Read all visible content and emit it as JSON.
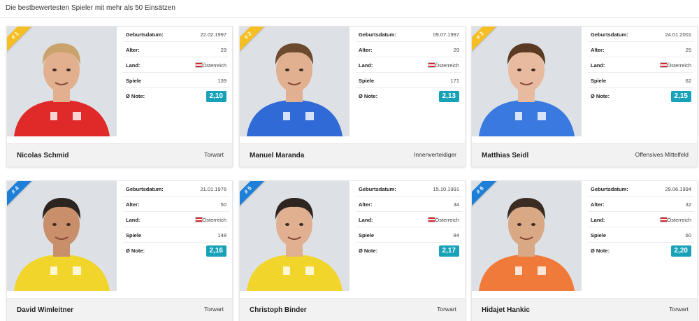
{
  "heading": "Die bestbewertesten Spieler mit mehr als 50 Einsätzen",
  "labels": {
    "birth": "Geburtsdatum:",
    "age": "Alter:",
    "country": "Land:",
    "games": "Spiele",
    "grade": "Ø Note:"
  },
  "colors": {
    "accent": "#17a2b8",
    "rank_top": "#f5bf24",
    "rank_other": "#1d7fd7"
  },
  "players": [
    {
      "rank": "# 1",
      "name": "Nicolas Schmid",
      "position": "Torwart",
      "birth": "22.02.1997",
      "age": "29",
      "country": "Österreich",
      "games": "139",
      "grade": "2,10",
      "kit": "#e02a2a",
      "skin": "#e2b08e",
      "hair": "#c9a36b"
    },
    {
      "rank": "# 2",
      "name": "Manuel Maranda",
      "position": "Innenverteidiger",
      "birth": "09.07.1997",
      "age": "29",
      "country": "Österreich",
      "games": "171",
      "grade": "2,13",
      "kit": "#2f6ad6",
      "skin": "#e0b090",
      "hair": "#6b4a2e"
    },
    {
      "rank": "# 3",
      "name": "Matthias Seidl",
      "position": "Offensives Mittelfeld",
      "birth": "24.01.2001",
      "age": "25",
      "country": "Österreich",
      "games": "62",
      "grade": "2,15",
      "kit": "#3a7ae0",
      "skin": "#e8bba0",
      "hair": "#5a3a22"
    },
    {
      "rank": "# 4",
      "name": "David Wimleitner",
      "position": "Torwart",
      "birth": "21.01.1976",
      "age": "50",
      "country": "Österreich",
      "games": "148",
      "grade": "2,16",
      "kit": "#f2d52a",
      "skin": "#c98f6a",
      "hair": "#2c2420"
    },
    {
      "rank": "# 5",
      "name": "Christoph Binder",
      "position": "Torwart",
      "birth": "15.10.1991",
      "age": "34",
      "country": "Österreich",
      "games": "84",
      "grade": "2,17",
      "kit": "#f2d52a",
      "skin": "#e0b090",
      "hair": "#2e2520"
    },
    {
      "rank": "# 6",
      "name": "Hidajet Hankic",
      "position": "Torwart",
      "birth": "29.06.1994",
      "age": "32",
      "country": "Österreich",
      "games": "60",
      "grade": "2,20",
      "kit": "#f07a3a",
      "skin": "#d9a884",
      "hair": "#3a2c22"
    }
  ]
}
